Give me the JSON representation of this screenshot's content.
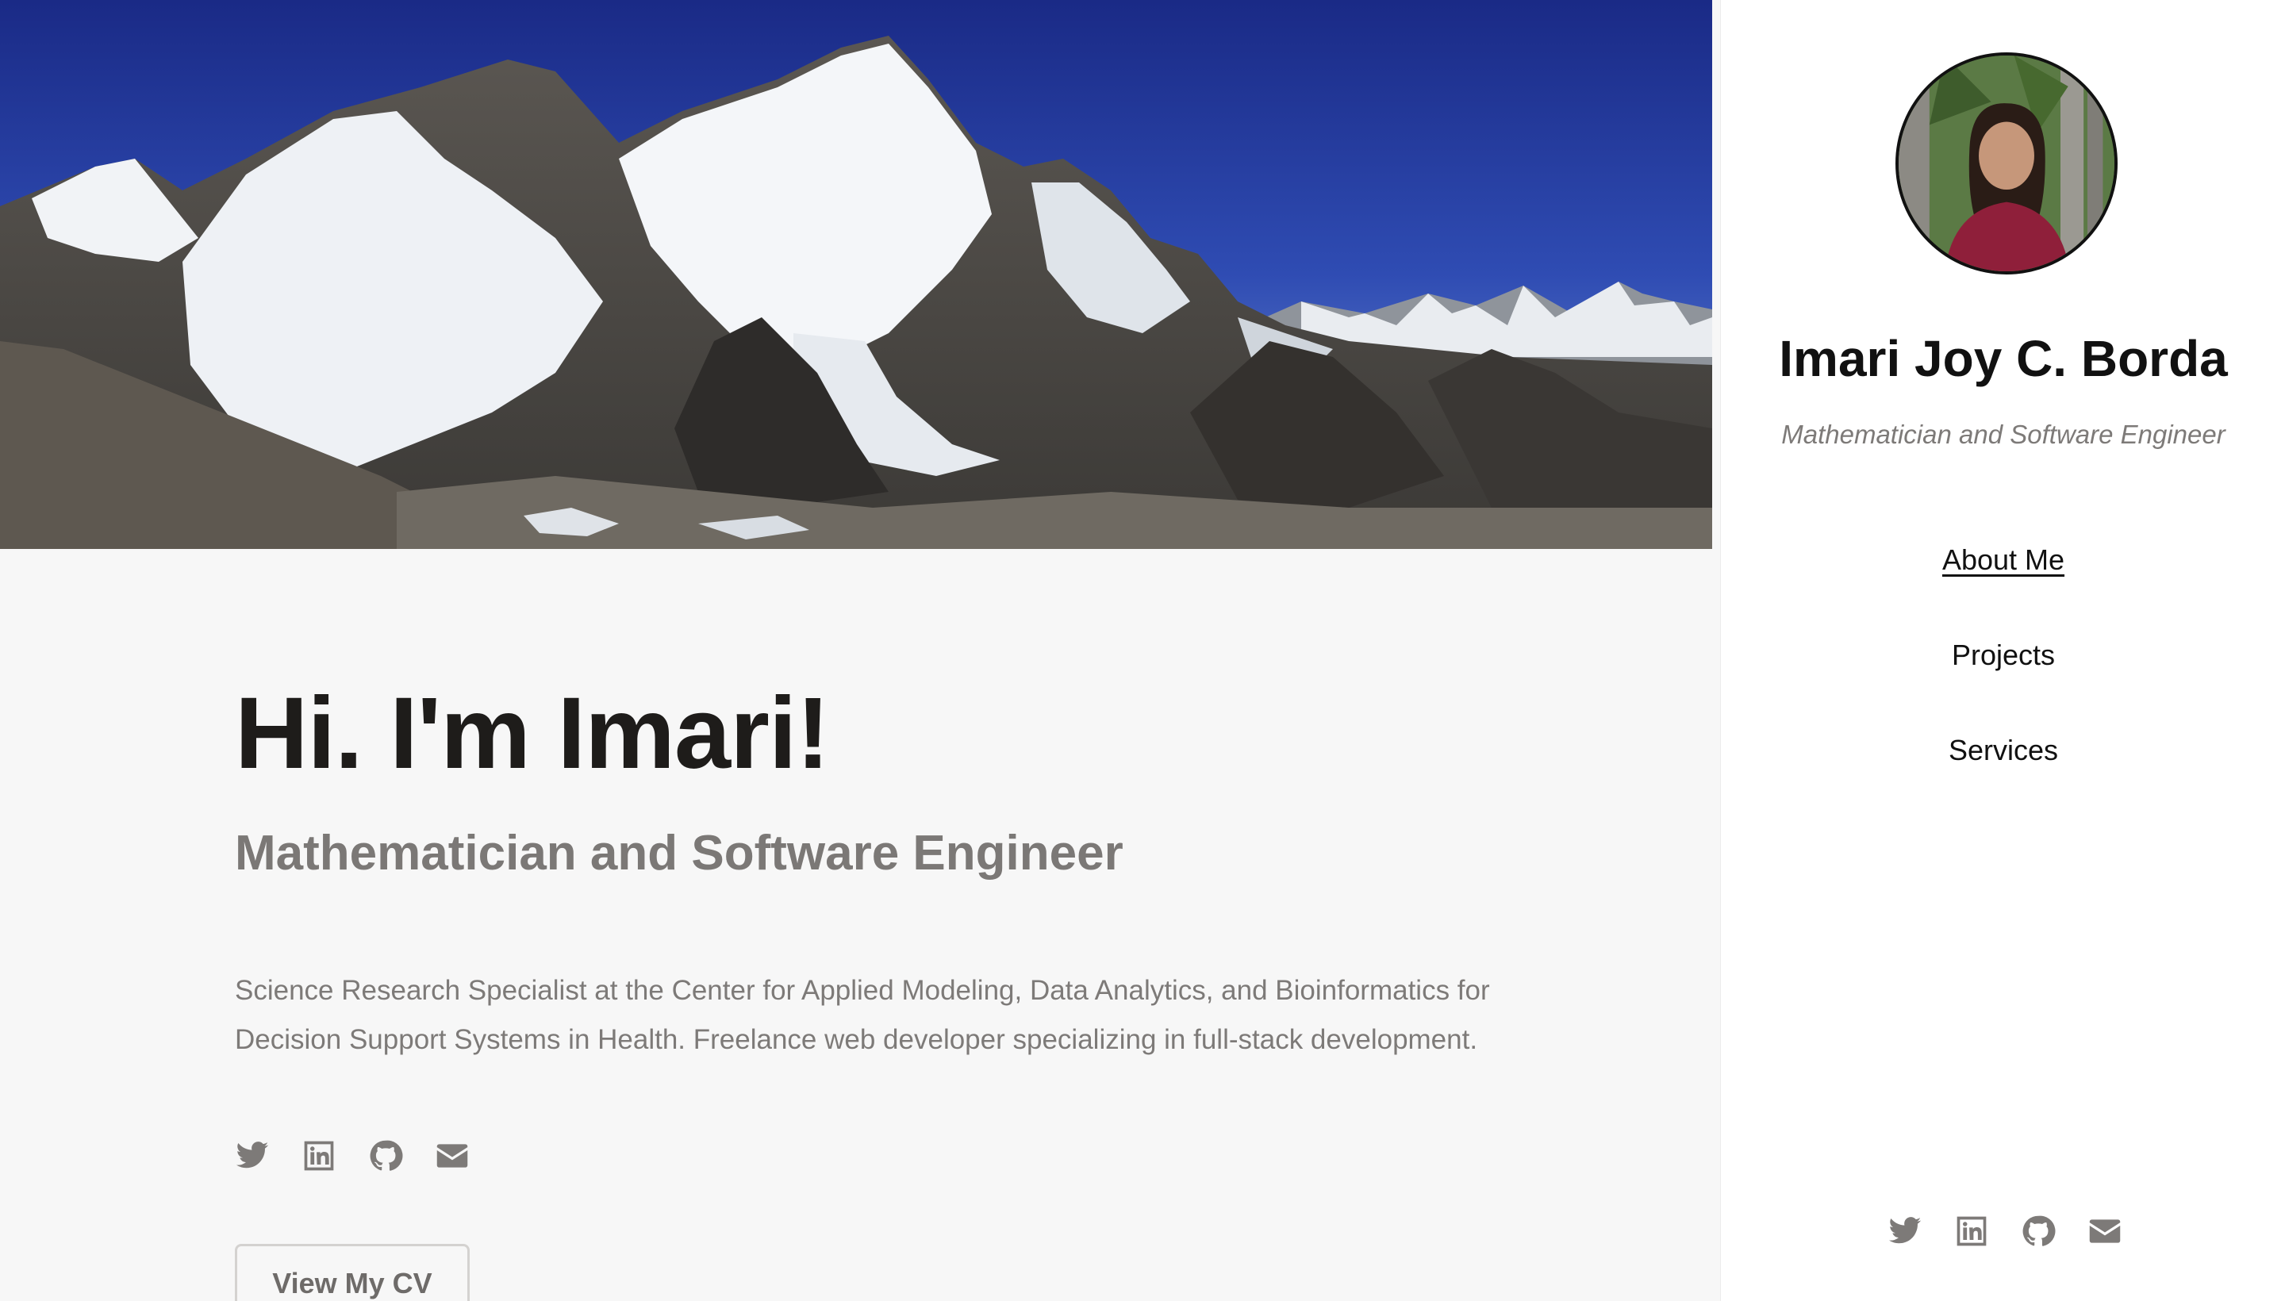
{
  "main": {
    "greeting": "Hi. I'm Imari!",
    "subtitle": "Mathematician and Software Engineer",
    "description": "Science Research Specialist at the Center for Applied Modeling, Data Analytics, and Bioinformatics for Decision Support Systems in Health. Freelance web developer specializing in full-stack development.",
    "cv_button_label": "View My CV",
    "hero_image_icon": "mountain-landscape-banner",
    "social_icons": [
      "twitter-icon",
      "linkedin-icon",
      "github-icon",
      "email-icon"
    ]
  },
  "sidebar": {
    "name": "Imari Joy C. Borda",
    "role": "Mathematician and Software Engineer",
    "avatar_icon": "profile-photo",
    "nav": [
      {
        "label": "About Me",
        "active": true
      },
      {
        "label": "Projects",
        "active": false
      },
      {
        "label": "Services",
        "active": false
      }
    ],
    "social_icons": [
      "twitter-icon",
      "linkedin-icon",
      "github-icon",
      "email-icon"
    ]
  },
  "colors": {
    "background": "#f7f7f7",
    "sidebar_background": "#ffffff",
    "heading": "#1e1c1a",
    "muted_text": "#7d7a78"
  }
}
